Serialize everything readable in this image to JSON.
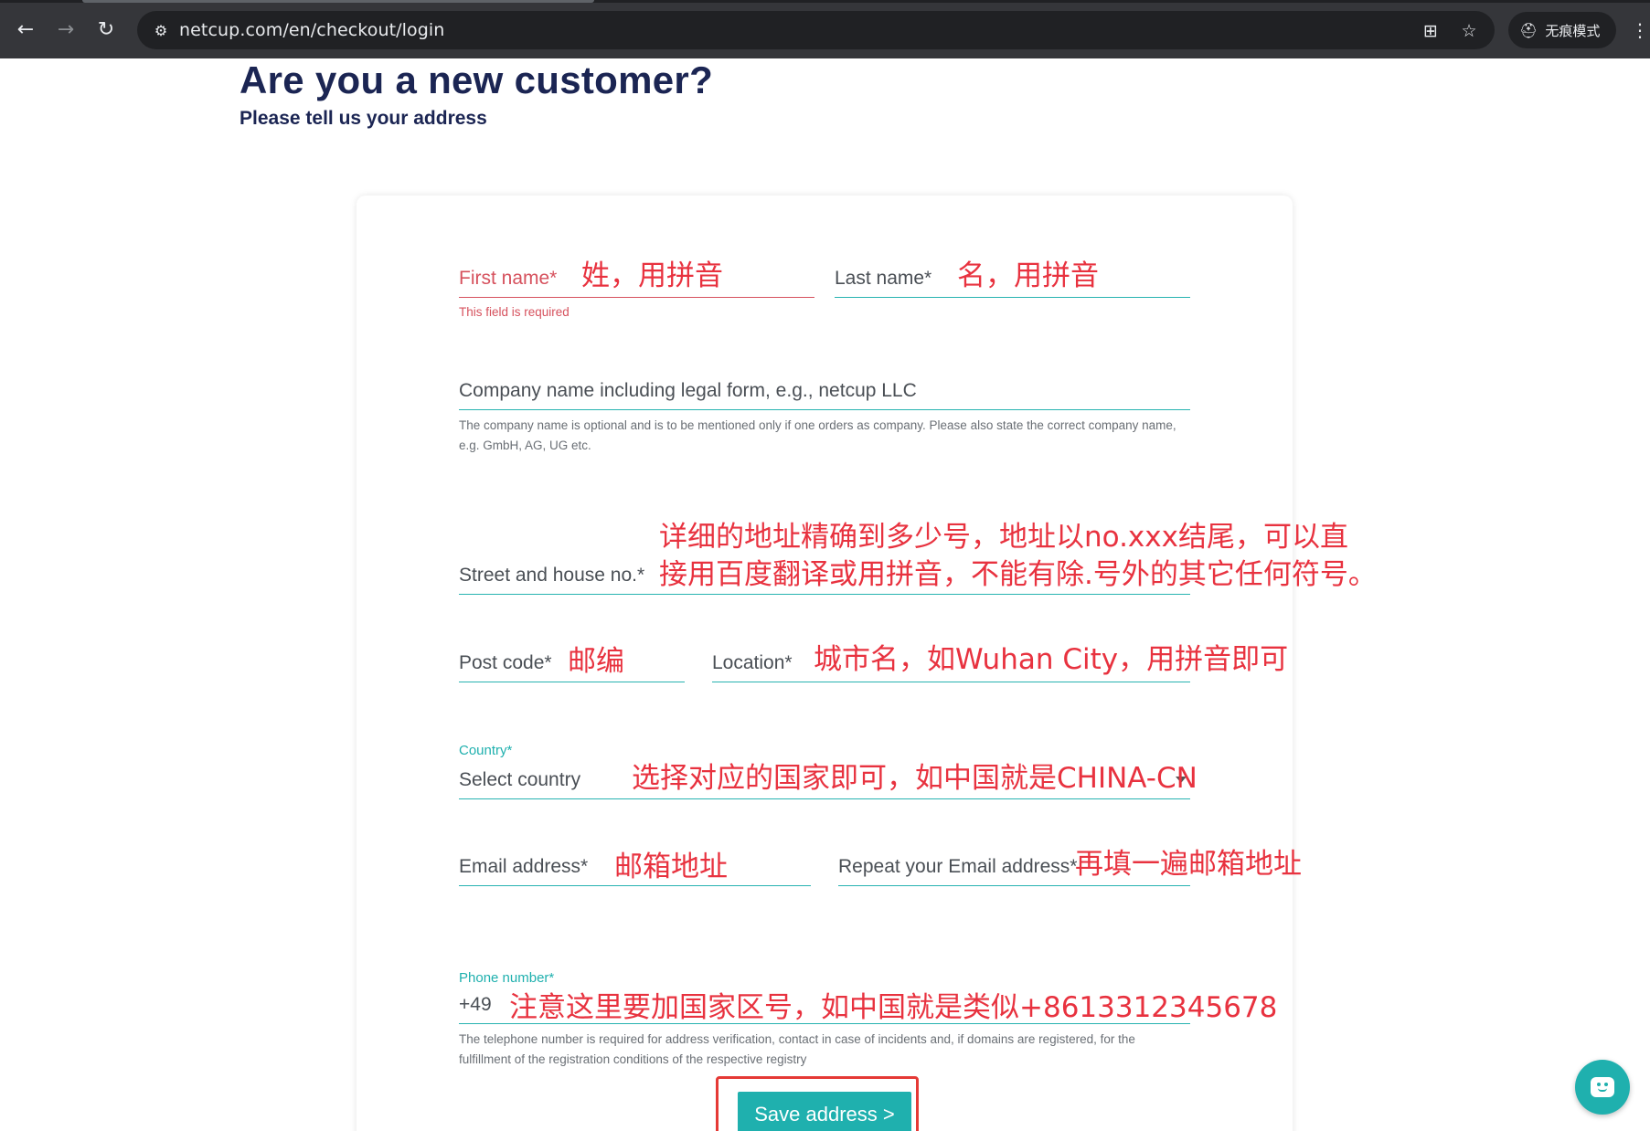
{
  "browser": {
    "url": "netcup.com/en/checkout/login",
    "incognito_label": "无痕模式"
  },
  "page": {
    "title": "Are you a new customer?",
    "subtitle": "Please tell us your address"
  },
  "form": {
    "first_name": {
      "label": "First name*",
      "error": "This field is required"
    },
    "last_name": {
      "label": "Last name*"
    },
    "company": {
      "label": "Company name including legal form, e.g., netcup LLC",
      "helper": "The company name is optional and is to be mentioned only if one orders as company. Please also state the correct company name, e.g. GmbH, AG, UG etc."
    },
    "street": {
      "label": "Street and house no.*"
    },
    "post_code": {
      "label": "Post code*"
    },
    "location": {
      "label": "Location*"
    },
    "country": {
      "float_label": "Country*",
      "value": "Select country"
    },
    "email": {
      "label": "Email address*"
    },
    "email_repeat": {
      "label": "Repeat your Email address*"
    },
    "phone": {
      "float_label": "Phone number*",
      "prefix": "+49",
      "helper": "The telephone number is required for address verification, contact in case of incidents and, if domains are registered, for the fulfillment of the registration conditions of the respective registry"
    },
    "save_label": "Save address >"
  },
  "annotations": {
    "first_name": "姓，用拼音",
    "last_name": "名，用拼音",
    "street_line1": "详细的地址精确到多少号，地址以no.xxx结尾，可以直",
    "street_line2": "接用百度翻译或用拼音，不能有除.号外的其它任何符号。",
    "post_code": "邮编",
    "location": "城市名，如Wuhan City，用拼音即可",
    "country": "选择对应的国家即可，如中国就是CHINA-CN",
    "email": "邮箱地址",
    "email_repeat": "再填一遍邮箱地址",
    "phone": "注意这里要加国家区号，如中国就是类似+8613312345678"
  },
  "colors": {
    "accent": "#1fb0ae",
    "error": "#d6515d",
    "heading": "#1b2553",
    "annotation": "#e8323f"
  }
}
